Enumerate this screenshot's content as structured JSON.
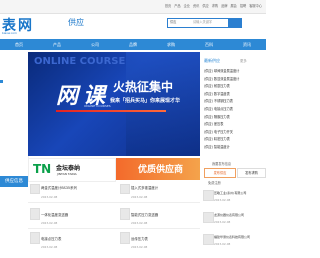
{
  "topbar": {
    "links": [
      "首页",
      "产品",
      "企业",
      "资讯",
      "供应",
      "求购",
      "品牌",
      "展会",
      "招聘",
      "客服中心"
    ]
  },
  "logo": {
    "text": "表网",
    "sub": "biaow.com"
  },
  "page": {
    "name": "供应"
  },
  "search": {
    "select": "供应",
    "placeholder": "请输入关键字",
    "button": "搜索"
  },
  "nav": {
    "items": [
      "首页",
      "产品",
      "公司",
      "品牌",
      "求购",
      "百科",
      "资讯"
    ]
  },
  "banner": {
    "online": "ONLINE COURSE",
    "wang": "网",
    "ke": "课",
    "hot": "火热征集中",
    "slogan": "我来「招兵买马」你来展现才华",
    "en": "ONLINE COURSES"
  },
  "right": {
    "title": "最新供应",
    "tab": "更多",
    "items": [
      "(供应) 球阀双金属温度计",
      "(供应) 数显双金属温度计",
      "(供应) 耐震压力表",
      "(供应) 数字温度表",
      "(供应) 不锈钢压力表",
      "(供应) 电接点压力表",
      "(供应) 隔膜压力表",
      "(供应) 差压表",
      "(供应) 电子压力开关",
      "(供应) 精密压力表",
      "(供应) 智能温度计"
    ]
  },
  "ads": {
    "tn": "TN",
    "tnname": "金坛泰纳",
    "tnsub": "JINTAN TAINA",
    "card2": "优质供应商"
  },
  "rbox": {
    "text": "我要发布信息",
    "btn1": "发布供应",
    "btn2": "发布求购",
    "bottom": "免费注册"
  },
  "section": {
    "title": "供应信息"
  },
  "products": [
    {
      "name": "两金式温度计BS35系列",
      "date": "2023-02-08"
    },
    {
      "name": "插入式多锥温度计",
      "date": "2023-02-08"
    },
    {
      "name": "一体化温度变送器",
      "date": "2023-02-08"
    },
    {
      "name": "智能式压力变送器",
      "date": "2023-02-08"
    },
    {
      "name": "电接点压力表",
      "date": "2023-02-08"
    },
    {
      "name": "远传压力表",
      "date": "2023-02-08"
    }
  ],
  "sidecompanies": [
    {
      "name": "压敏工业(泰州)有限公司",
      "date": "2023-02-08"
    },
    {
      "name": "龙源仪器仪表有限公司",
      "date": "2023-02-08"
    },
    {
      "name": "福建华测仪表科技有限公司",
      "date": "2023-02-08"
    }
  ]
}
